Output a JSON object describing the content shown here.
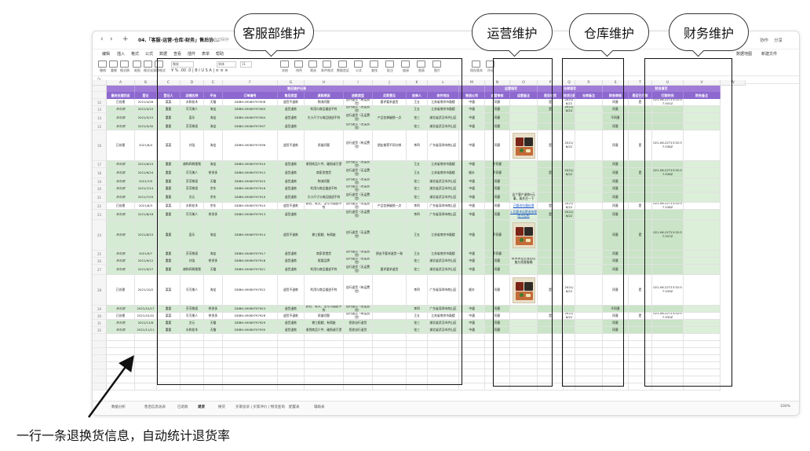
{
  "titlebar": {
    "nav": [
      "‹",
      "›",
      "+"
    ],
    "doc_title": "04.「客服-运营-仓库-财务」售后协...",
    "autosave": "⊙ 自动保存",
    "right": [
      "协作",
      "分享"
    ]
  },
  "menus": [
    "编辑",
    "插入",
    "格式",
    "公式",
    "数据",
    "查看",
    "插件",
    "表单",
    "帮助"
  ],
  "menu_right": [
    "数据地图",
    "新建文件"
  ],
  "toolbar": {
    "items": [
      "撤销",
      "重做",
      "格式刷",
      "粘贴",
      "格式化",
      "清除格式"
    ],
    "font_name": "微软",
    "font_family": "宋体",
    "font_size": "11",
    "format_row": "¥ % .00 .0 | B I U S A | ≡ ≡ ≡",
    "right_items": [
      "冻结",
      "排序",
      "筛选",
      "条件格式",
      "数据验证",
      "公式",
      "查找",
      "批注",
      "链接",
      "图表",
      "图片",
      "保存版本",
      "评论"
    ]
  },
  "formula": {
    "fx": "fx"
  },
  "columns": {
    "letters": [
      "A",
      "B",
      "C",
      "D",
      "E",
      "F",
      "G",
      "H",
      "I",
      "J",
      "K",
      "L",
      "M",
      "N",
      "O",
      "P",
      "Q",
      "R",
      "S",
      "T",
      "U",
      "V",
      "W"
    ]
  },
  "groups": {
    "kefu": "售后维护记录",
    "yunying": "运营填写",
    "cangku": "仓库填写",
    "caiwu": "财务填写"
  },
  "headers": [
    "最终处理状态",
    "登记",
    "登记人",
    "店铺名称",
    "平台",
    "订单编号",
    "售后类型",
    "退款原因",
    "退款类型",
    "买家意见",
    "创单人",
    "收件地址",
    "物流公司",
    "运营审核",
    "运营备注",
    "是否收货",
    "收货日期",
    "仓库备注",
    "财务审核",
    "是否已打款",
    "打款时间",
    "财务备注"
  ],
  "rows": [
    {
      "n": "12",
      "v": [
        "已处理",
        "2021/4/28",
        "菜菜",
        "水和花木",
        "天猫",
        "DDBH-09089797908",
        "退货不退款",
        "物流问题",
        "自行退货（有运费险）",
        "要评要求退货",
        "王五",
        "江苏省南京市鼓楼",
        "中通",
        "同意",
        "",
        "是",
        "2021/6/22",
        "",
        "同意",
        "是",
        "021-06-22T13:32:57.541Z",
        ""
      ]
    },
    {
      "n": "13",
      "v": [
        "未处理",
        "2021/5/10",
        "重要",
        "可可美人",
        "淘宝",
        "DDBH-09089797083",
        "退货退款",
        "利用与商品描述不符",
        "自行退货（无运费险）",
        "",
        "王五",
        "江苏省南京市鼓楼",
        "中通",
        "同意",
        "",
        "是",
        "2021/6/22",
        "",
        "同意",
        "",
        "",
        ""
      ]
    },
    {
      "n": "14",
      "v": [
        "未处理",
        "2021/5/15",
        "重要",
        "夏乐",
        "淘宝",
        "DDBH-09089797084",
        "退货退款",
        "大小尺寸与商品描述不符",
        "自行退货（无运费险）",
        "产品包装破损一点",
        "张三",
        "湖北省武汉市洪山区",
        "中通",
        "同意",
        "",
        "",
        "",
        "",
        "不同意",
        "",
        "",
        ""
      ]
    },
    {
      "n": "15",
      "v": [
        "未处理",
        "2021/5/30",
        "重要",
        "芬芳物语",
        "淘宝",
        "DDBH-09089797097",
        "退货退款",
        "",
        "自行退货（无运费险）",
        "",
        "张三",
        "湖北省武汉市洪山区",
        "中通",
        "同意",
        "",
        "",
        "",
        "",
        "同意",
        "",
        "",
        ""
      ]
    },
    {
      "n": "16",
      "v": [
        "已处理",
        "2021/6/4",
        "菜菜",
        "刘浩",
        "淘宝",
        "DDBH-09089797096",
        "退货不退款",
        "质量问题",
        "自行退货（有运费险）",
        "朋友推荐不同分辨",
        "李四",
        "广东省深圳市南山区",
        "中通",
        "同意",
        "",
        "是",
        "2021/6/22",
        "",
        "同意",
        "是",
        "021-06-22T13:32:57.538Z",
        ""
      ]
    },
    {
      "n": "17",
      "v": [
        "未处理",
        "2021/6/15",
        "重要",
        "谢和四周视频",
        "淘宝",
        "DDBH-09089797910",
        "退货退款",
        "收到商品少件、破损或污渍",
        "自行退货（无运费险）",
        "",
        "王五",
        "江苏省南京市鼓楼",
        "中通",
        "不同意",
        "",
        "",
        "",
        "",
        "同意",
        "",
        "",
        ""
      ]
    },
    {
      "n": "18",
      "v": [
        "未处理",
        "2021/6/24",
        "重要",
        "可可美人",
        "拼多多",
        "DDBH-09089797912",
        "退货退款",
        "商家发错货",
        "自行退货（无运费险）",
        "",
        "王五",
        "江苏省南京市鼓楼",
        "顺丰",
        "不同意",
        "",
        "是",
        "2021/6/22",
        "",
        "同意",
        "是",
        "021-06-22T13:32:57.536Z",
        ""
      ]
    },
    {
      "n": "19",
      "v": [
        "未处理",
        "2021/7/9",
        "重要",
        "芬芳物语",
        "天猫",
        "DDBH-09089797915",
        "退货退款",
        "物流问题",
        "自行退货（无运费险）",
        "",
        "张三",
        "湖北省武汉市洪山区",
        "中通",
        "同意",
        "",
        "",
        "",
        "",
        "同意",
        "",
        "",
        ""
      ]
    },
    {
      "n": "20",
      "v": [
        "未处理",
        "2021/7/14",
        "重要",
        "芬芳物语",
        "京东",
        "DDBH-09089797916",
        "退货退款",
        "利用与商品描述不符",
        "自行退货（无运费险）",
        "",
        "张三",
        "湖北省武汉市洪山区",
        "中通",
        "同意",
        "",
        "",
        "",
        "",
        "同意",
        "",
        "",
        ""
      ]
    },
    {
      "n": "21",
      "v": [
        "未处理",
        "2021/7/29",
        "重要",
        "文元",
        "京东",
        "DDBH-09089797919",
        "退货退款",
        "大小尺寸与商品描述不符",
        "自行退货（无运费险）",
        "",
        "张三",
        "湖北省武汉市洪山区",
        "中通",
        "同意",
        "这个客户退款9元事，请关注一下",
        "",
        "",
        "",
        "同意",
        "",
        "",
        ""
      ]
    },
    {
      "n": "22",
      "v": [
        "已处理",
        "2021/8/3",
        "菜菜",
        "水和花木",
        "京东",
        "DDBH-09089797910",
        "退货不退款",
        "颜色、款式、型号与描述不符",
        "自行退货（无运费险）",
        "产品包装破损一点",
        "李四",
        "广东省深圳市南山区",
        "中通",
        "同意",
        "已跟进沟通处理",
        "是",
        "2021/6/22",
        "",
        "同意",
        "是",
        "021-06-22T13:32:57.538Z",
        ""
      ]
    },
    {
      "n": "23",
      "v": [
        "未处理",
        "2021/8/18",
        "重要",
        "可可美人",
        "拼多多",
        "DDBH-09089797913",
        "退货退款",
        "",
        "自行退货（无运费险）",
        "",
        "李四",
        "广东省深圳市南山区",
        "中通",
        "同意",
        "1.后要求运营追加保险不见的",
        "是",
        "2021/6/22",
        "",
        "同意",
        "",
        "",
        ""
      ]
    },
    {
      "n": "24",
      "v": [
        "未处理",
        "2021/8/23",
        "重要",
        "夏乐",
        "淘宝",
        "DDBH-09089797914",
        "退货不退款",
        "做工粗糙、有瑕疵",
        "自行退货（无运费险）",
        "",
        "王五",
        "江苏省南京市鼓楼",
        "中通",
        "不同意",
        "",
        "",
        "",
        "",
        "同意",
        "是",
        "021-06-22T13:32:57.537Z",
        ""
      ]
    },
    {
      "n": "25",
      "v": [
        "未处理",
        "2021/9/7",
        "重要",
        "芬芳物语",
        "淘宝",
        "DDBH-09089797917",
        "退货退款",
        "商家发错货",
        "自行退货（无运费险）",
        "朋友不要求退货一致",
        "王五",
        "江苏省南京市鼓楼",
        "中通",
        "不同意",
        "",
        "",
        "",
        "",
        "同意",
        "",
        "",
        ""
      ]
    },
    {
      "n": "26",
      "v": [
        "未处理",
        "2021/9/12",
        "重要",
        "刘浩",
        "拼多多",
        "DDBH-09089797918",
        "退货退款",
        "假冒品牌",
        "自行退货（无运费险）",
        "",
        "张三",
        "湖北省武汉市洪山区",
        "中通",
        "同意",
        "拼多多是交流后回复分类客服确",
        "",
        "",
        "",
        "同意",
        "",
        "",
        ""
      ]
    },
    {
      "n": "27",
      "v": [
        "未处理",
        "2021/9/27",
        "重要",
        "谢和四周视频",
        "天猫",
        "DDBH-09089797921",
        "退货退款",
        "利用与商品描述不符",
        "自行退货（无运费险）",
        "要评要求退货",
        "张三",
        "湖北省武汉市洪山区",
        "中通",
        "同意",
        "",
        "",
        "",
        "",
        "同意",
        "",
        "",
        ""
      ]
    },
    {
      "n": "28",
      "v": [
        "已处理",
        "2021/10/2",
        "菜菜",
        "可可美人",
        "淘宝",
        "DDBH-09089797922",
        "退货不退款",
        "利用与商品描述不符",
        "自行退货（有运费险）",
        "",
        "李四",
        "广东省深圳市南山区",
        "顺丰",
        "同意",
        "",
        "是",
        "2021/6/22",
        "",
        "同意",
        "是",
        "021-06-22T13:32:57.539Z",
        ""
      ]
    },
    {
      "n": "29",
      "v": [
        "未处理",
        "2021/10/17",
        "重要",
        "芬芳物语",
        "拼多多",
        "DDBH-09089797923",
        "退货退款",
        "颜色、款式、型号与描述不符",
        "自行退货（无运费险）",
        "",
        "李四",
        "广东省深圳市南山区",
        "中通",
        "同意",
        "",
        "",
        "",
        "",
        "不同意",
        "",
        "",
        ""
      ]
    },
    {
      "n": "30",
      "v": [
        "已处理",
        "2021/10/22",
        "菜菜",
        "可可美人",
        "拼多多",
        "DDBH-09089797926",
        "退货不退款",
        "质量问题",
        "自行退货（有运费险）",
        "",
        "王五",
        "江苏省南京市鼓楼",
        "中通",
        "同意",
        "",
        "是",
        "2021/6/22",
        "",
        "同意",
        "是",
        "021-06-22T13:32:57.530Z",
        ""
      ]
    },
    {
      "n": "31",
      "v": [
        "未处理",
        "2021/11/6",
        "重要",
        "文元",
        "天猫",
        "DDBH-09089797929",
        "退货退款",
        "做工粗糙、有瑕疵",
        "拒收自行退货",
        "",
        "张三",
        "湖北省武汉市洪山区",
        "中通",
        "同意",
        "",
        "",
        "",
        "",
        "同意",
        "",
        "",
        ""
      ]
    },
    {
      "n": "32",
      "v": [
        "未处理",
        "2021/11/11",
        "重要",
        "水和花木",
        "天猫",
        "DDBH-09089797930",
        "退货退款",
        "收到商品少件、破损或污渍",
        "拒收自行退货",
        "",
        "张三",
        "湖北省武汉市洪山区",
        "中通",
        "同意",
        "",
        "",
        "",
        "",
        "同意",
        "",
        "",
        ""
      ]
    }
  ],
  "sheets": [
    "数据分析",
    "售后信息总表",
    "已退款",
    "退货",
    "换货",
    "买家投诉 | 买家评价 | 物流查询",
    "配置表",
    "辅助表"
  ],
  "active_sheet": "退货",
  "zoom": "100%",
  "annotations": {
    "kefu": "客服部维护",
    "yunying": "运营维护",
    "cangku": "仓库维护",
    "caiwu": "财务维护",
    "caption": "一行一条退换货信息，自动统计退货率"
  }
}
